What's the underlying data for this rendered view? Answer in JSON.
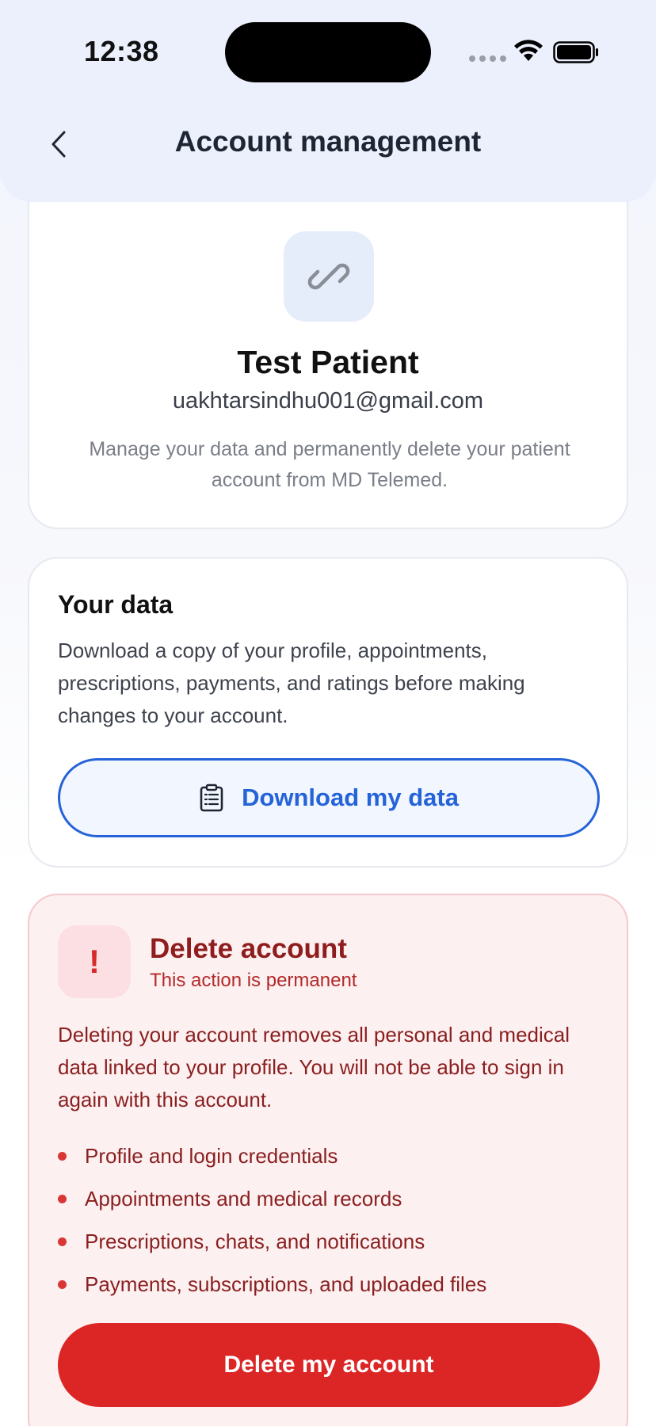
{
  "status_bar": {
    "time": "12:38"
  },
  "header": {
    "title": "Account management"
  },
  "profile": {
    "name": "Test Patient",
    "email": "uakhtarsindhu001@gmail.com",
    "description": "Manage your data and permanently delete your patient account from MD Telemed.",
    "icon": "link-icon"
  },
  "your_data": {
    "title": "Your data",
    "description": "Download a copy of your profile, appointments, prescriptions, payments, and ratings before making changes to your account.",
    "button_label": "Download my data",
    "button_icon": "clipboard-icon"
  },
  "delete_account": {
    "badge": "!",
    "title": "Delete account",
    "subtitle": "This action is permanent",
    "description": "Deleting your account removes all personal and medical data linked to your profile. You will not be able to sign in again with this account.",
    "items": [
      "Profile and login credentials",
      "Appointments and medical records",
      "Prescriptions, chats, and notifications",
      "Payments, subscriptions, and uploaded files"
    ],
    "button_label": "Delete my account"
  },
  "colors": {
    "accent_blue": "#2563d9",
    "danger_red": "#dc2626",
    "header_bg": "#ebf0fc"
  }
}
